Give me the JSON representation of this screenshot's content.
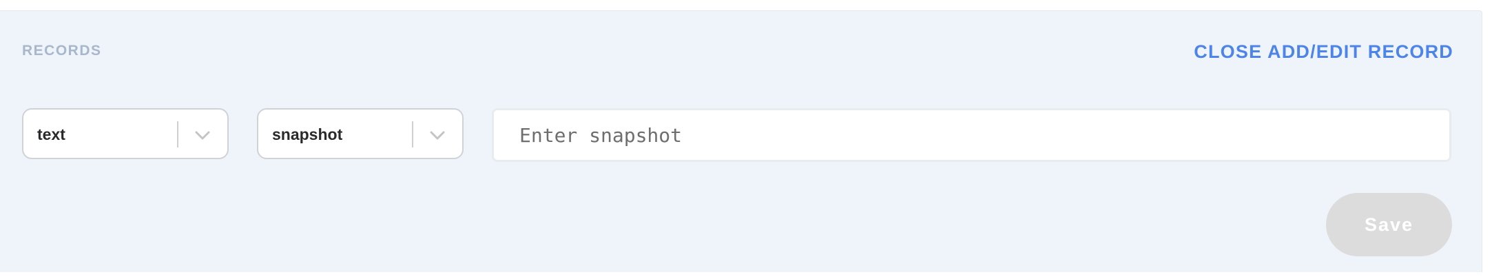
{
  "records": {
    "title": "RECORDS",
    "close_link_label": "CLOSE ADD/EDIT RECORD"
  },
  "form": {
    "type_select": {
      "selected": "text",
      "icon": "chevron-down-icon"
    },
    "kind_select": {
      "selected": "snapshot",
      "icon": "chevron-down-icon"
    },
    "value_input": {
      "value": "",
      "placeholder": "Enter snapshot"
    },
    "save_label": "Save"
  },
  "colors": {
    "panel_background": "#eff4fb",
    "title_text": "#a8b7c9",
    "link_accent": "#4c84e8",
    "disabled_button": "#dcdcdc"
  }
}
